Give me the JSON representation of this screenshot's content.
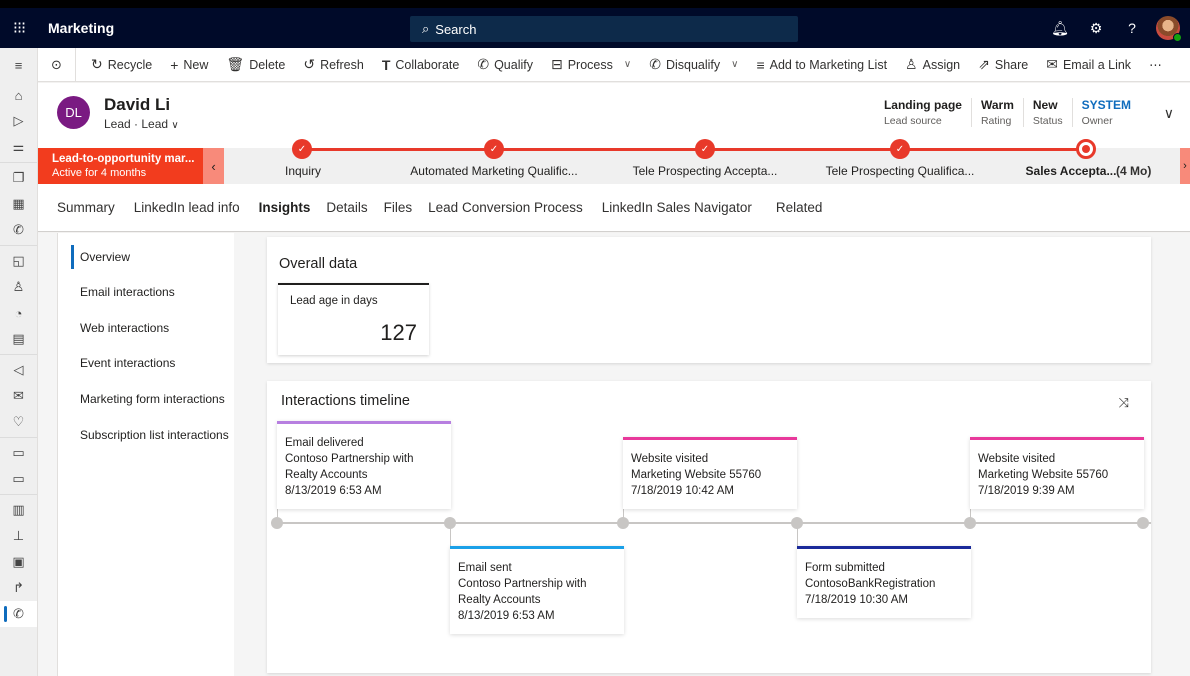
{
  "topbar": {
    "app_name": "Marketing",
    "search_placeholder": "Search",
    "icons": [
      "waffle-icon",
      "bell-icon",
      "gear-icon",
      "help-icon",
      "user-avatar"
    ]
  },
  "leftnav": {
    "icons": [
      "hamburger-icon",
      "home-icon",
      "recent-icon",
      "pinned-icon",
      "copy-icon",
      "calendar-icon",
      "phone-icon",
      "notes-icon",
      "person-icon",
      "chart-icon",
      "document-icon",
      "megaphone-icon",
      "mail-icon",
      "heart-icon",
      "calendar-icon",
      "calendar-icon",
      "form-icon",
      "page-icon",
      "template-icon",
      "journey-icon",
      "phone-gear-icon"
    ]
  },
  "commandbar": {
    "items": [
      {
        "label": "Recycle",
        "icon": "recycle-icon"
      },
      {
        "label": "New",
        "icon": "plus-icon"
      },
      {
        "label": "Delete",
        "icon": "trash-icon"
      },
      {
        "label": "Refresh",
        "icon": "refresh-icon"
      },
      {
        "label": "Collaborate",
        "icon": "teams-icon"
      },
      {
        "label": "Qualify",
        "icon": "qualify-icon"
      },
      {
        "label": "Process",
        "icon": "process-icon",
        "dropdown": true
      },
      {
        "label": "Disqualify",
        "icon": "disqualify-icon",
        "dropdown": true
      },
      {
        "label": "Add to Marketing List",
        "icon": "add-list-icon"
      },
      {
        "label": "Assign",
        "icon": "assign-icon"
      },
      {
        "label": "Share",
        "icon": "share-icon"
      },
      {
        "label": "Email a Link",
        "icon": "email-link-icon"
      }
    ],
    "more_label": "⋯"
  },
  "record": {
    "initials": "DL",
    "name": "David Li",
    "entity": "Lead",
    "form": "Lead",
    "fields": [
      {
        "value": "Landing page",
        "label": "Lead source"
      },
      {
        "value": "Warm",
        "label": "Rating"
      },
      {
        "value": "New",
        "label": "Status"
      },
      {
        "value": "SYSTEM",
        "label": "Owner"
      }
    ]
  },
  "process": {
    "name": "Lead-to-opportunity mar...",
    "active_for": "Active for 4 months",
    "stages": [
      {
        "label": "Inquiry",
        "status": "complete"
      },
      {
        "label": "Automated Marketing Qualific...",
        "status": "complete"
      },
      {
        "label": "Tele Prospecting Accepta...",
        "status": "complete"
      },
      {
        "label": "Tele Prospecting Qualifica...",
        "status": "complete"
      },
      {
        "label": "Sales Accepta...",
        "status": "current"
      }
    ],
    "current_duration": "(4 Mo)"
  },
  "tabs": [
    "Summary",
    "LinkedIn lead info",
    "Insights",
    "Details",
    "Files",
    "Lead Conversion Process",
    "LinkedIn Sales Navigator",
    "Related"
  ],
  "active_tab": "Insights",
  "subnav": {
    "items": [
      "Overview",
      "Email interactions",
      "Web interactions",
      "Event interactions",
      "Marketing form interactions",
      "Subscription list interactions"
    ],
    "active": "Overview"
  },
  "overall": {
    "title": "Overall data",
    "tile_label": "Lead age in days",
    "tile_value": "127"
  },
  "timeline": {
    "title": "Interactions timeline",
    "events": [
      {
        "type": "Email delivered",
        "detail": "Contoso Partnership with Realty Accounts",
        "time": "8/13/2019 6:53 AM",
        "color": "#b77fe0",
        "position": "above"
      },
      {
        "type": "Email sent",
        "detail": "Contoso Partnership with Realty Accounts",
        "time": "8/13/2019 6:53 AM",
        "color": "#1aa0e8",
        "position": "below"
      },
      {
        "type": "Website visited",
        "detail": "Marketing Website 55760",
        "time": "7/18/2019 10:42 AM",
        "color": "#e8399b",
        "position": "above"
      },
      {
        "type": "Form submitted",
        "detail": "ContosoBankRegistration",
        "time": "7/18/2019 10:30 AM",
        "color": "#1a2a9a",
        "position": "below"
      },
      {
        "type": "Website visited",
        "detail": "Marketing Website 55760",
        "time": "7/18/2019 9:39 AM",
        "color": "#e8399b",
        "position": "above"
      }
    ]
  }
}
